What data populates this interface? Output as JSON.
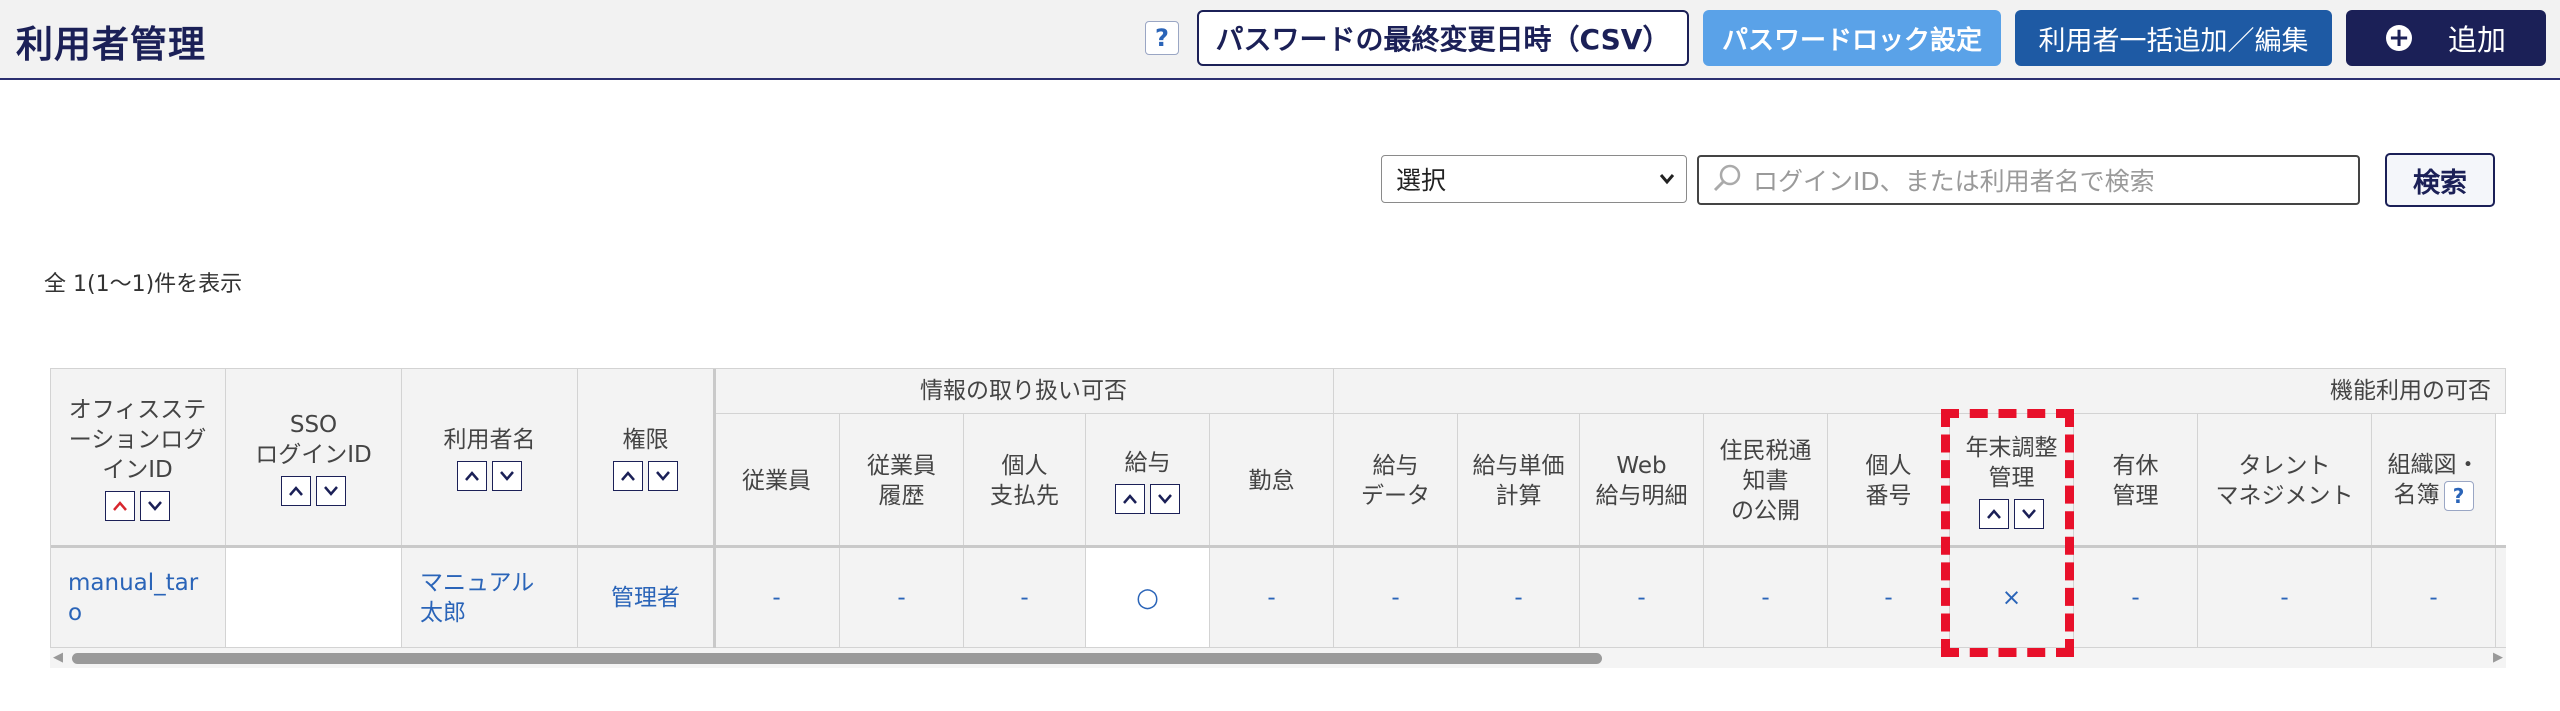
{
  "header": {
    "title": "利用者管理",
    "help": "?",
    "csv_button": "パスワードの最終変更日時（CSV）",
    "lock_button": "パスワードロック設定",
    "bulk_button": "利用者一括追加／編集",
    "add_button": "追加"
  },
  "search": {
    "select_value": "選択",
    "placeholder": "ログインID、または利用者名で検索",
    "button": "検索"
  },
  "result_count": "全 1(1〜1)件を表示",
  "table": {
    "headers": {
      "office_login_id": [
        "オフィスステ",
        "ーションログ",
        "インID"
      ],
      "sso_login_id": [
        "SSO",
        "ログインID"
      ],
      "user_name": "利用者名",
      "role": "権限",
      "group_info": "情報の取り扱い可否",
      "group_feature": "機能利用の可否",
      "employee": "従業員",
      "employee_history": [
        "従業員",
        "履歴"
      ],
      "personal_payee": [
        "個人",
        "支払先"
      ],
      "salary": "給与",
      "attendance": "勤怠",
      "salary_data": [
        "給与",
        "データ"
      ],
      "salary_unit_calc": [
        "給与単価",
        "計算"
      ],
      "web_payslip": [
        "Web",
        "給与明細"
      ],
      "resident_tax": [
        "住民税通",
        "知書",
        "の公開"
      ],
      "my_number": [
        "個人",
        "番号"
      ],
      "year_end": [
        "年末調整",
        "管理"
      ],
      "paid_leave": [
        "有休",
        "管理"
      ],
      "talent": [
        "タレント",
        "マネジメント"
      ],
      "org_chart": [
        "組織図・",
        "名簿"
      ]
    },
    "sort_up": "^",
    "sort_down": "v",
    "row": {
      "login_id": [
        "manual_tar",
        "o"
      ],
      "sso_id": "",
      "user_name": [
        "マニュアル",
        "太郎"
      ],
      "role": "管理者",
      "employee": "-",
      "employee_history": "-",
      "personal_payee": "-",
      "salary": "○",
      "attendance": "-",
      "salary_data": "-",
      "salary_unit_calc": "-",
      "web_payslip": "-",
      "resident_tax": "-",
      "my_number": "-",
      "year_end": "×",
      "paid_leave": "-",
      "talent": "-",
      "org_chart": "-"
    }
  },
  "colors": {
    "navy": "#1b2057",
    "light_blue": "#5aa2e8",
    "blue": "#1e5aa4",
    "link": "#2a64b8",
    "highlight": "#e8102a"
  }
}
